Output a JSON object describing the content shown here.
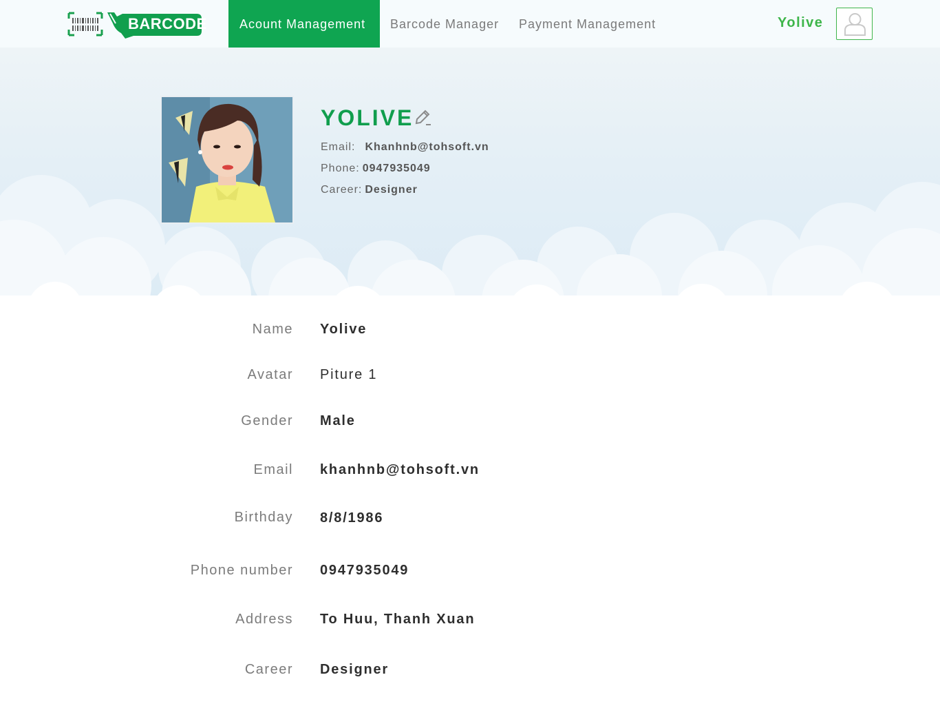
{
  "nav": {
    "logo_text": "BARCODE",
    "tabs": [
      {
        "label": "Acount Management",
        "active": true
      },
      {
        "label": "Barcode Manager",
        "active": false
      },
      {
        "label": "Payment Management",
        "active": false
      }
    ],
    "username": "Yolive",
    "accent_color": "#0fa551"
  },
  "profile": {
    "name": "YOLIVE",
    "email_label": "Email:",
    "email": "Khanhnb@tohsoft.vn",
    "phone_label": "Phone:",
    "phone": "0947935049",
    "career_label": "Career:",
    "career": "Designer"
  },
  "details": [
    {
      "label": "Name",
      "value": "Yolive"
    },
    {
      "label": "Avatar",
      "value": "Piture 1"
    },
    {
      "label": "Gender",
      "value": "Male"
    },
    {
      "label": "Email",
      "value": "khanhnb@tohsoft.vn"
    },
    {
      "label": "Birthday",
      "value": "8/8/1986"
    },
    {
      "label": "Phone number",
      "value": "0947935049"
    },
    {
      "label": "Address",
      "value": "To Huu, Thanh Xuan"
    },
    {
      "label": "Career",
      "value": "Designer"
    }
  ]
}
